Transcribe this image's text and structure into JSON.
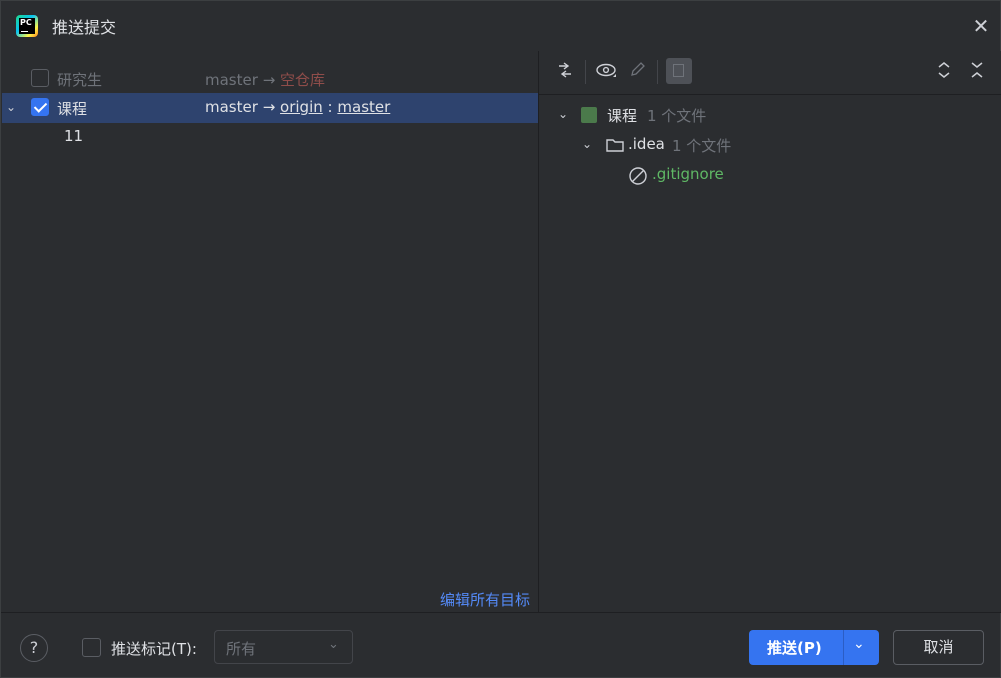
{
  "window": {
    "title": "推送提交",
    "app_icon": "pycharm-logo-icon",
    "app_icon_text": "PC"
  },
  "repos": [
    {
      "name": "研究生",
      "checked": false,
      "source_branch": "master",
      "arrow": "→",
      "target": "空仓库"
    },
    {
      "name": "课程",
      "checked": true,
      "source_branch": "master",
      "arrow": "→",
      "remote": "origin",
      "separator": ":",
      "remote_branch": "master",
      "commits": [
        "11"
      ]
    }
  ],
  "left_panel": {
    "edit_all_targets": "编辑所有目标"
  },
  "toolbar": {
    "icons": [
      "compare-arrows-icon",
      "eye-icon",
      "pencil-icon",
      "group-by-icon",
      "expand-all-icon",
      "collapse-all-icon"
    ]
  },
  "file_tree": {
    "root": {
      "label": "课程",
      "count": "1 个文件"
    },
    "folder": {
      "label": ".idea",
      "count": "1 个文件"
    },
    "file": {
      "label": ".gitignore"
    }
  },
  "bottom": {
    "help": "?",
    "push_tags_label": "推送标记(T):",
    "push_tags_checked": false,
    "tags_select_value": "所有",
    "push_button": "推送(P)",
    "cancel_button": "取消"
  },
  "colors": {
    "accent": "#3574f0",
    "selection": "#2e436e",
    "link": "#548af7",
    "empty_repo": "#8f4d4a",
    "ignored_file": "#5fb865"
  }
}
